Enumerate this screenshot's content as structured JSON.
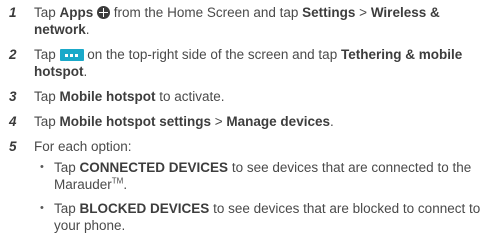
{
  "steps": [
    {
      "num": "1",
      "t1": "Tap ",
      "b1": "Apps",
      "t2": " from the Home Screen and tap ",
      "b2": "Settings",
      "t3": " > ",
      "b3": "Wireless & network",
      "t4": "."
    },
    {
      "num": "2",
      "t1": "Tap ",
      "t2": " on the top-right side of the screen and tap ",
      "b1": "Tethering & mobile hotspot",
      "t3": "."
    },
    {
      "num": "3",
      "t1": "Tap ",
      "b1": "Mobile hotspot",
      "t2": " to activate."
    },
    {
      "num": "4",
      "t1": "Tap ",
      "b1": "Mobile hotspot settings",
      "t2": " > ",
      "b2": "Manage devices",
      "t3": "."
    },
    {
      "num": "5",
      "t1": "For each option:"
    }
  ],
  "bullets": [
    {
      "t1": "Tap ",
      "b1": "CONNECTED DEVICES",
      "t2": " to see devices that are connected to the Marauder",
      "sup": "TM",
      "t3": "."
    },
    {
      "t1": "Tap ",
      "b1": "BLOCKED DEVICES",
      "t2": " to see devices that are blocked to connect to your phone."
    }
  ],
  "icons": {
    "apps": "apps-plus-icon",
    "menu": "more-menu-icon"
  },
  "colors": {
    "menu_icon": "#1aa9c9"
  }
}
